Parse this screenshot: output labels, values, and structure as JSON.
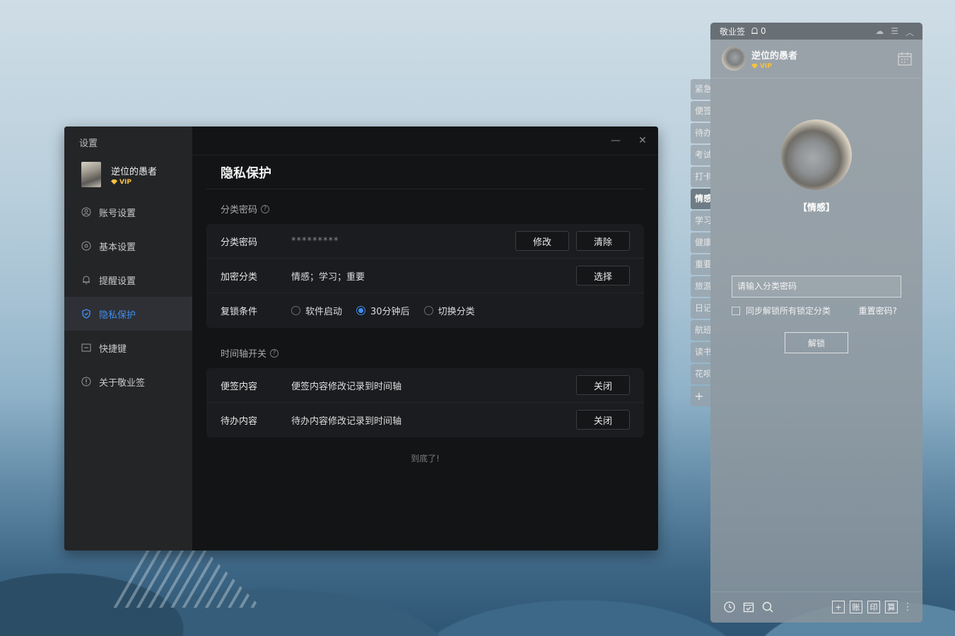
{
  "settings": {
    "title": "设置",
    "user": {
      "name": "逆位的愚者",
      "vip": "VIP"
    },
    "nav": [
      {
        "label": "账号设置",
        "icon": "user-icon"
      },
      {
        "label": "基本设置",
        "icon": "gear-icon"
      },
      {
        "label": "提醒设置",
        "icon": "bell-icon"
      },
      {
        "label": "隐私保护",
        "icon": "shield-icon",
        "active": true
      },
      {
        "label": "快捷键",
        "icon": "keyboard-icon"
      },
      {
        "label": "关于敬业签",
        "icon": "info-icon"
      }
    ],
    "window": {
      "minimize": "—",
      "close": "✕"
    },
    "page_title": "隐私保护",
    "section1": {
      "label": "分类密码",
      "password_label": "分类密码",
      "password_value": "*********",
      "modify_btn": "修改",
      "clear_btn": "清除",
      "encrypt_label": "加密分类",
      "encrypt_value": "情感；学习；重要",
      "select_btn": "选择",
      "relock_label": "复锁条件",
      "relock_options": [
        "软件启动",
        "30分钟后",
        "切换分类"
      ],
      "relock_selected": 1
    },
    "section2": {
      "label": "时间轴开关",
      "note_label": "便签内容",
      "note_desc": "便签内容修改记录到时间轴",
      "note_btn": "关闭",
      "todo_label": "待办内容",
      "todo_desc": "待办内容修改记录到时间轴",
      "todo_btn": "关闭"
    },
    "end_note": "到底了!"
  },
  "tabs": [
    "紧急",
    "便签",
    "待办",
    "考试",
    "打卡",
    "情感",
    "学习",
    "健康",
    "重要",
    "旅游",
    "日记",
    "航班",
    "读书",
    "花呗",
    "+"
  ],
  "tabs_active": 5,
  "panel": {
    "app_name": "敬业签",
    "bell_count": "0",
    "user": {
      "name": "逆位的愚者",
      "vip": "VIP"
    },
    "category": "【情感】",
    "password_placeholder": "请输入分类密码",
    "sync_unlock": "同步解锁所有锁定分类",
    "reset_password": "重置密码?",
    "unlock_btn": "解锁",
    "footer_right": [
      "+",
      "账",
      "印",
      "算"
    ]
  },
  "colors": {
    "accent": "#3f8ef0",
    "vip_gold": "#f5c242"
  }
}
